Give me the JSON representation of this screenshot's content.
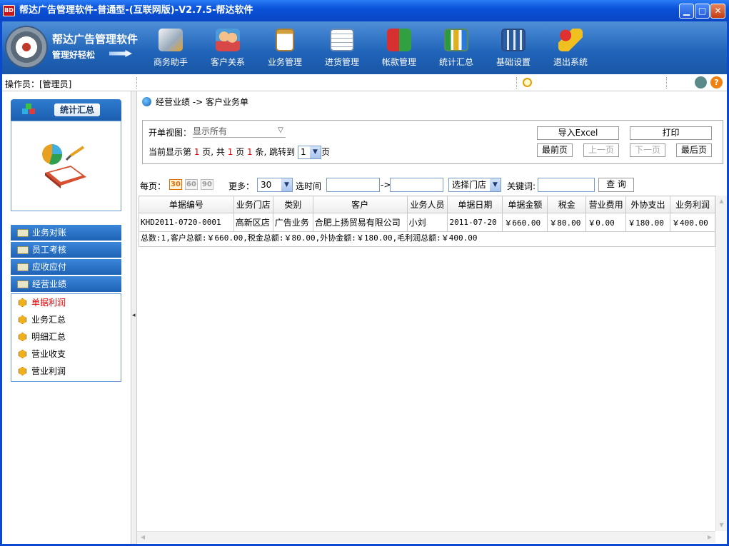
{
  "window": {
    "title": "帮达广告管理软件-普通型-(互联网版)-V2.7.5-帮达软件",
    "logo_text": "BD",
    "minimize_glyph": "▁",
    "maximize_glyph": "□",
    "close_glyph": "✕"
  },
  "brand": {
    "name": "帮达广告管理软件",
    "slogan": "管理好轻松"
  },
  "toolbar": {
    "items": [
      {
        "label": "商务助手",
        "icon": "pen-tablet-icon"
      },
      {
        "label": "客户关系",
        "icon": "people-icon"
      },
      {
        "label": "业务管理",
        "icon": "clipboard-icon"
      },
      {
        "label": "进货管理",
        "icon": "notepad-pen-icon"
      },
      {
        "label": "帐款管理",
        "icon": "arrows-exchange-icon"
      },
      {
        "label": "统计汇总",
        "icon": "bar-chart-icon"
      },
      {
        "label": "基础设置",
        "icon": "calculator-icon"
      },
      {
        "label": "退出系统",
        "icon": "exit-person-icon"
      }
    ]
  },
  "status": {
    "operator": "操作员：[管理员]",
    "help_glyph": "?"
  },
  "sidebar": {
    "header": "统计汇总",
    "menus": [
      {
        "label": "业务对账"
      },
      {
        "label": "员工考核"
      },
      {
        "label": "应收应付"
      },
      {
        "label": "经营业绩"
      }
    ],
    "subitems": [
      {
        "label": "单据利润",
        "active": true
      },
      {
        "label": "业务汇总"
      },
      {
        "label": "明细汇总"
      },
      {
        "label": "营业收支"
      },
      {
        "label": "营业利润"
      }
    ],
    "collapse_glyph": "◂"
  },
  "main": {
    "breadcrumb": "经营业绩  -> 客户业务单",
    "view_label": "开单视图：",
    "view_value": "显示所有",
    "page_info": {
      "prefix": "当前显示第 ",
      "current": "1",
      "mid1": " 页, 共 ",
      "total_pages": "1",
      "mid2": " 页 ",
      "count": "1",
      "suffix": " 条,  跳转到",
      "jump_value": "1",
      "end": "页"
    },
    "buttons": {
      "export": "导入Excel",
      "print": "打印",
      "first": "最前页",
      "prev": "上一页",
      "next": "下一页",
      "last": "最后页"
    },
    "filter": {
      "per_page_label": "每页：",
      "per_page_options": [
        "30",
        "60",
        "90"
      ],
      "more_label": "更多：",
      "more_value": "30",
      "time_label": "选时间",
      "time_sep": "->",
      "store_select": "选择门店",
      "keyword_label": "关键词:",
      "query_button": "查 询"
    },
    "table": {
      "columns": [
        "单据编号",
        "业务门店",
        "类别",
        "客户",
        "业务人员",
        "单据日期",
        "单据金额",
        "税金",
        "营业费用",
        "外协支出",
        "业务利润"
      ],
      "rows": [
        [
          "KHD2011-0720-0001",
          "高新区店",
          "广告业务",
          "合肥上扬贸易有限公司",
          "小刘",
          "2011-07-20",
          "￥660.00",
          "￥80.00",
          "￥0.00",
          "￥180.00",
          "￥400.00"
        ]
      ],
      "summary": "总数:1,客户总额:￥660.00,税金总额:￥80.00,外协金额:￥180.00,毛利润总额:￥400.00"
    },
    "scroll_glyphs": {
      "up": "▲",
      "down": "▼",
      "left": "◀",
      "right": "▶"
    }
  },
  "colors": {
    "title_bar": "#0a52d8",
    "toolbar": "#1f63b8",
    "accent_red": "#e00000",
    "per_page_active": "#e07000"
  }
}
